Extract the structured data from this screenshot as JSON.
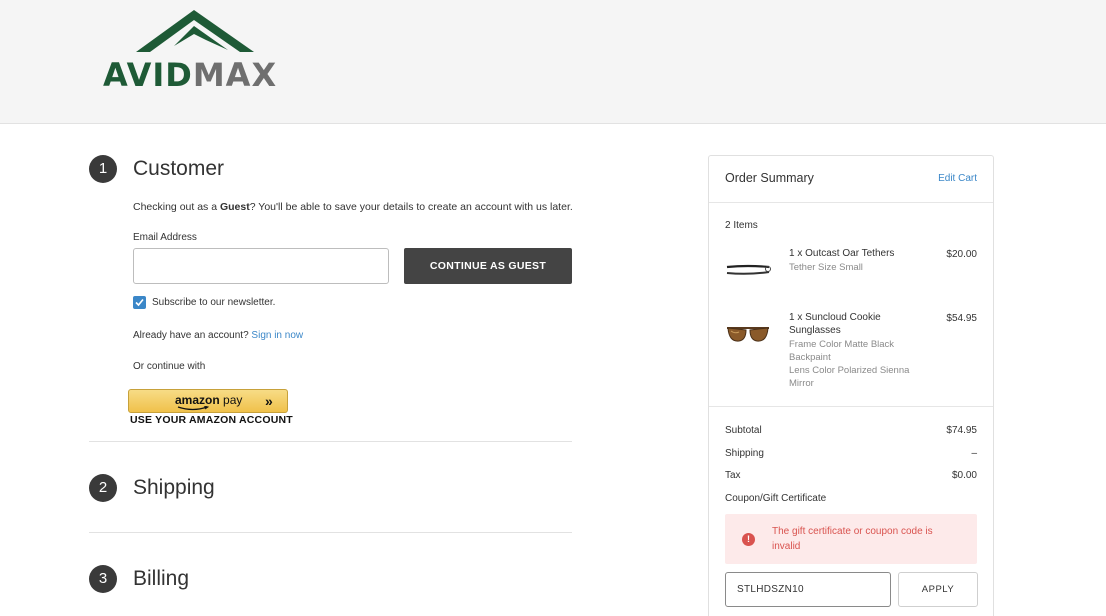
{
  "brand": {
    "name_part1": "AVID",
    "name_part2": "MAX",
    "green": "#1e5a36",
    "gray": "#6f6f6f"
  },
  "steps": [
    {
      "number": "1",
      "title": "Customer"
    },
    {
      "number": "2",
      "title": "Shipping"
    },
    {
      "number": "3",
      "title": "Billing"
    }
  ],
  "customer": {
    "intro_prefix": "Checking out as a ",
    "intro_bold": "Guest",
    "intro_suffix": "? You'll be able to save your details to create an account with us later.",
    "email_label": "Email Address",
    "email_value": "",
    "continue_button": "CONTINUE AS GUEST",
    "subscribe_label": "Subscribe to our newsletter.",
    "subscribe_checked": true,
    "account_prompt": "Already have an account?",
    "sign_in_link": "Sign in now",
    "or_continue": "Or continue with",
    "amazon_word": "amazon",
    "amazon_pay_word": "pay",
    "amazon_chevrons": "»",
    "amazon_subtitle": "USE YOUR AMAZON ACCOUNT"
  },
  "summary": {
    "title": "Order Summary",
    "edit_cart": "Edit Cart",
    "items_count": "2 Items",
    "items": [
      {
        "name": "1 x Outcast Oar Tethers",
        "details": [
          "Tether Size Small"
        ],
        "price": "$20.00",
        "thumb_icon": "oar-tether-image"
      },
      {
        "name_line1": "1 x Suncloud Cookie",
        "name_line2": "Sunglasses",
        "details": [
          "Frame Color Matte Black",
          "Backpaint",
          "Lens Color Polarized Sienna",
          "Mirror"
        ],
        "price": "$54.95",
        "thumb_icon": "sunglasses-image"
      }
    ],
    "subtotal_label": "Subtotal",
    "subtotal_value": "$74.95",
    "shipping_label": "Shipping",
    "shipping_value": "–",
    "tax_label": "Tax",
    "tax_value": "$0.00",
    "coupon_link": "Coupon/Gift Certificate",
    "error_icon": "!",
    "error_message": "The gift certificate or coupon code is invalid",
    "coupon_value": "STLHDSZN10",
    "apply_button": "APPLY",
    "error_color": "#d9534f",
    "link_color": "#3b87c8"
  }
}
